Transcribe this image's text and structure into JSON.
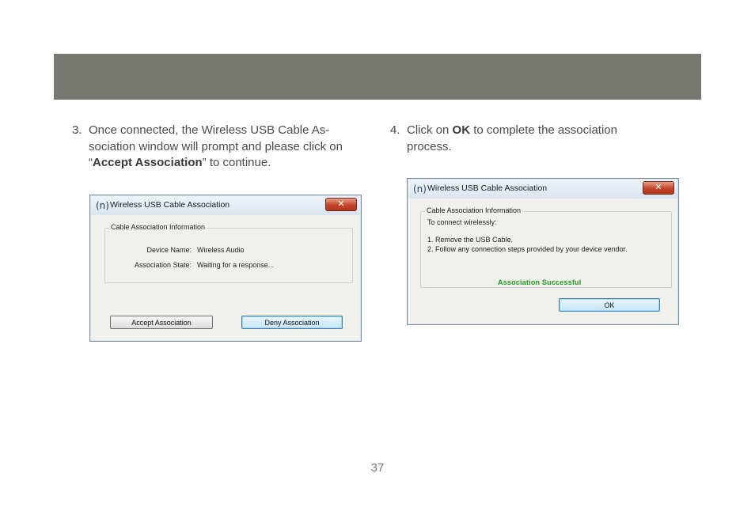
{
  "step3": {
    "number": "3.",
    "text_before": "Once connected, the Wireless USB Cable As-sociation window will prompt and please click on “",
    "bold": "Accept Association",
    "text_after": "” to continue."
  },
  "step4": {
    "number": "4.",
    "text_before": "Click on ",
    "bold": "OK",
    "text_after": " to complete the association process."
  },
  "dialog1": {
    "title": "Wireless USB Cable Association",
    "close_glyph": "✕",
    "group_label": "Cable Association Information",
    "device_name_label": "Device Name:",
    "device_name_value": "Wireless Audio",
    "association_state_label": "Association State:",
    "association_state_value": "Waiting for a response...",
    "accept_button": "Accept Association",
    "deny_button": "Deny Association"
  },
  "dialog2": {
    "title": "Wireless USB Cable Association",
    "close_glyph": "✕",
    "group_label": "Cable Association Information",
    "line1": "To connect wirelessly:",
    "line2": "1.  Remove the USB Cable.",
    "line3": "2.  Follow any connection steps provided by your device vendor.",
    "success_text": "Association Successful",
    "ok_button": "OK"
  },
  "icons": {
    "app_icon": "(n)"
  },
  "page_number": "37",
  "colors": {
    "header_band": "#777872",
    "success_green": "#1e9a1e"
  }
}
